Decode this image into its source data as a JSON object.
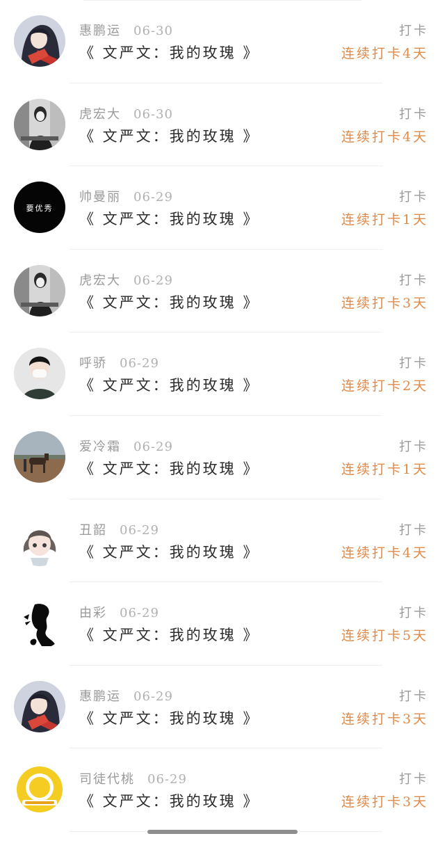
{
  "colors": {
    "name": "#9a9a9a",
    "title": "#2b2b2b",
    "streak": "#e08a48",
    "divider": "#efefef"
  },
  "entries": [
    {
      "avatar": "anime-girl-red-avatar",
      "name": "惠鹏运",
      "date": "06-30",
      "title": "《 文严文：我的玫瑰 》",
      "kind": "打卡",
      "streak": "连续打卡4天"
    },
    {
      "avatar": "bw-woman-photo-avatar",
      "name": "虎宏大",
      "date": "06-30",
      "title": "《 文严文：我的玫瑰 》",
      "kind": "打卡",
      "streak": "连续打卡4天"
    },
    {
      "avatar": "black-logo-avatar",
      "avatar_text": "要优秀",
      "name": "帅曼丽",
      "date": "06-29",
      "title": "《 文严文：我的玫瑰 》",
      "kind": "打卡",
      "streak": "连续打卡1天"
    },
    {
      "avatar": "bw-woman-photo-avatar",
      "name": "虎宏大",
      "date": "06-29",
      "title": "《 文严文：我的玫瑰 》",
      "kind": "打卡",
      "streak": "连续打卡3天"
    },
    {
      "avatar": "masked-boy-avatar",
      "name": "呼骄",
      "date": "06-29",
      "title": "《 文严文：我的玫瑰 》",
      "kind": "打卡",
      "streak": "连续打卡2天"
    },
    {
      "avatar": "horse-landscape-avatar",
      "name": "爱冷霜",
      "date": "06-29",
      "title": "《 文严文：我的玫瑰 》",
      "kind": "打卡",
      "streak": "连续打卡1天"
    },
    {
      "avatar": "anime-chibi-girl-avatar",
      "name": "丑韶",
      "date": "06-29",
      "title": "《 文严文：我的玫瑰 》",
      "kind": "打卡",
      "streak": "连续打卡4天"
    },
    {
      "avatar": "silhouette-girl-avatar",
      "name": "由彩",
      "date": "06-29",
      "title": "《 文严文：我的玫瑰 》",
      "kind": "打卡",
      "streak": "连续打卡5天"
    },
    {
      "avatar": "anime-girl-red-avatar",
      "name": "惠鹏运",
      "date": "06-29",
      "title": "《 文严文：我的玫瑰 》",
      "kind": "打卡",
      "streak": "连续打卡3天"
    },
    {
      "avatar": "yellow-badge-avatar",
      "name": "司徒代桃",
      "date": "06-29",
      "title": "《 文严文：我的玫瑰 》",
      "kind": "打卡",
      "streak": "连续打卡3天"
    }
  ]
}
